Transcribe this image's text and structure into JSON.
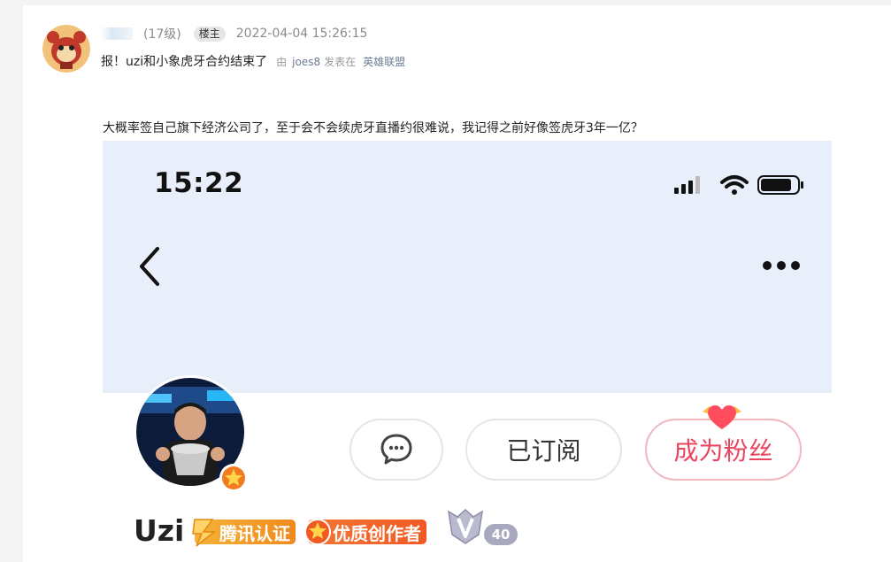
{
  "post": {
    "author_level": "(17级)",
    "owner_badge": "楼主",
    "timestamp": "2022-04-04 15:26:15",
    "title": "报！uzi和小象虎牙合约结束了",
    "by_label": "由",
    "by_user": "joes8",
    "posted_in_label": "发表在",
    "forum": "英雄联盟",
    "body": "大概率签自己旗下经济公司了，至于会不会续虎牙直播约很难说，我记得之前好像签虎牙3年一亿？"
  },
  "screenshot": {
    "clock": "15:22",
    "buttons": {
      "subscribed": "已订阅",
      "become_fan": "成为粉丝"
    },
    "profile": {
      "name": "Uzi",
      "badges": [
        "腾讯认证",
        "优质创作者"
      ],
      "level": "40"
    },
    "colors": {
      "header_bg": "#e9eefb",
      "fan_accent": "#e94560",
      "tencent_badge": "#f6b23a",
      "creator_badge": "#f15a24"
    },
    "icons": [
      "signal-icon",
      "wifi-icon",
      "battery-icon",
      "back-arrow-icon",
      "more-icon",
      "chat-bubble-icon",
      "heart-icon",
      "star-icon",
      "level-shield-icon"
    ]
  }
}
